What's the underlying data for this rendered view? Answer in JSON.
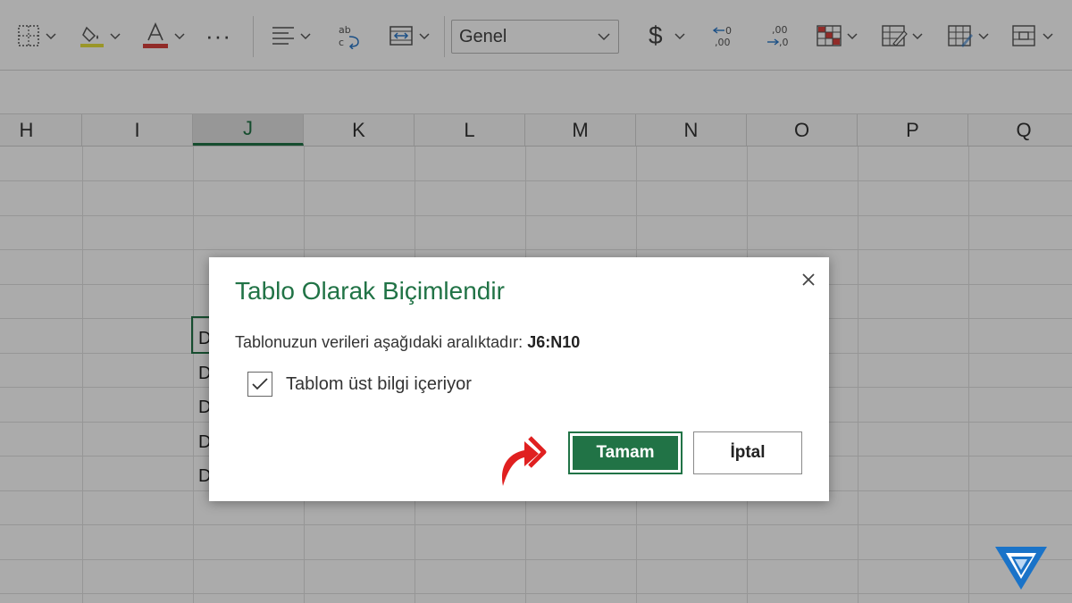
{
  "ribbon": {
    "number_format": "Genel",
    "currency_symbol": "$",
    "more_label": "···",
    "decrease_decimal": "←0\n,00",
    "increase_decimal": ",00\n→,0"
  },
  "columns": [
    "H",
    "I",
    "J",
    "K",
    "L",
    "M",
    "N",
    "O",
    "P",
    "Q"
  ],
  "selected_column": "J",
  "cells": [
    "D",
    "D",
    "D",
    "D",
    "D"
  ],
  "dialog": {
    "title": "Tablo Olarak Biçimlendir",
    "range_text": "Tablonuzun verileri aşağıdaki aralıktadır:",
    "range_value": "J6:N10",
    "checkbox_label": "Tablom üst bilgi içeriyor",
    "checkbox_checked": true,
    "ok_label": "Tamam",
    "cancel_label": "İptal"
  },
  "colors": {
    "accent": "#217346",
    "arrow": "#e02020",
    "logo": "#1a73c8"
  }
}
